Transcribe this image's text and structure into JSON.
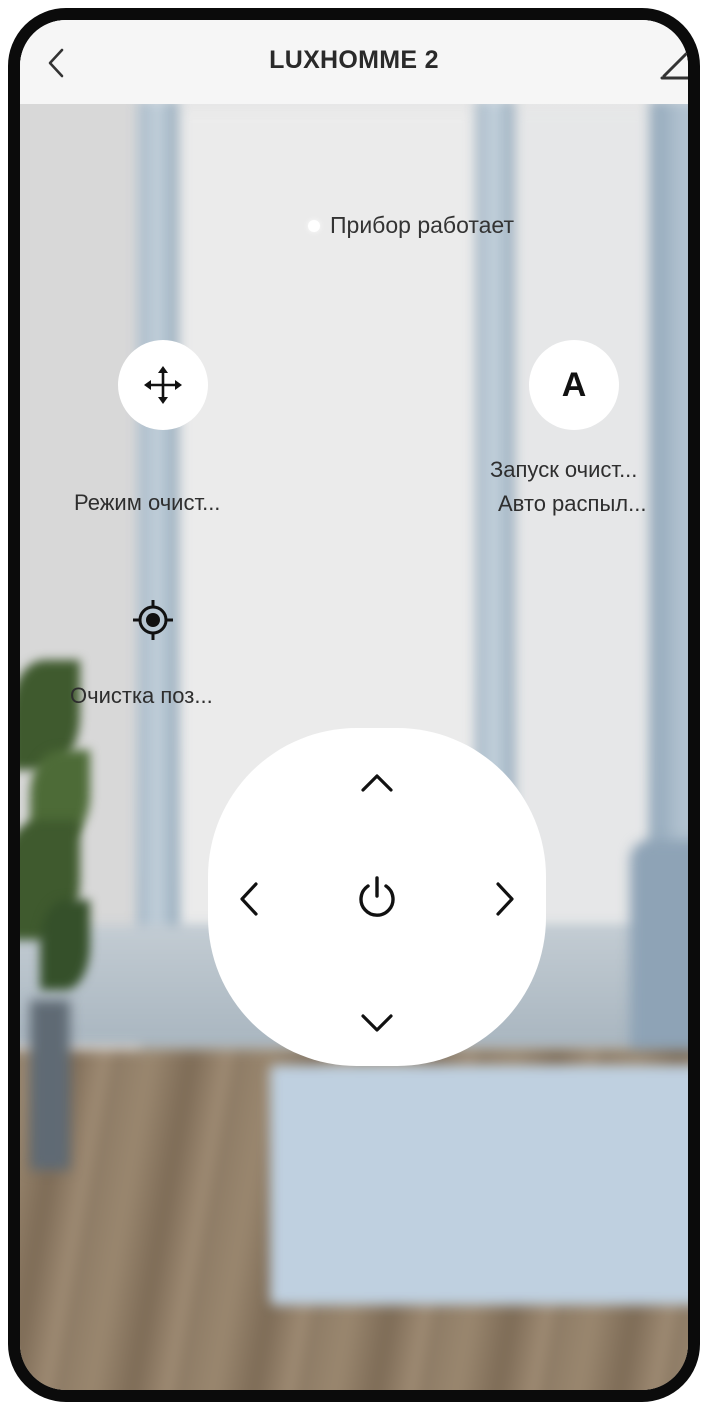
{
  "header": {
    "title": "LUXHOMME 2",
    "back_icon": "chevron-left-icon",
    "edit_icon": "edit-pencil-icon"
  },
  "status": {
    "text": "Прибор работает",
    "dot_color": "#ffffff"
  },
  "controls": {
    "cleaning_mode": {
      "icon": "move-arrows-icon",
      "label": "Режим очист..."
    },
    "auto": {
      "icon_letter": "A",
      "label_line1": "Запуск очист...",
      "label_line2": "Авто распыл..."
    },
    "spot_cleaning": {
      "icon": "target-icon",
      "label": "Очистка поз..."
    }
  },
  "dpad": {
    "up_icon": "chevron-up-icon",
    "down_icon": "chevron-down-icon",
    "left_icon": "chevron-left-icon",
    "right_icon": "chevron-right-icon",
    "center_icon": "power-icon"
  },
  "colors": {
    "header_bg": "#f6f6f6",
    "button_bg": "#ffffff",
    "icon_color": "#111111",
    "text_color": "#2e2e2e"
  }
}
